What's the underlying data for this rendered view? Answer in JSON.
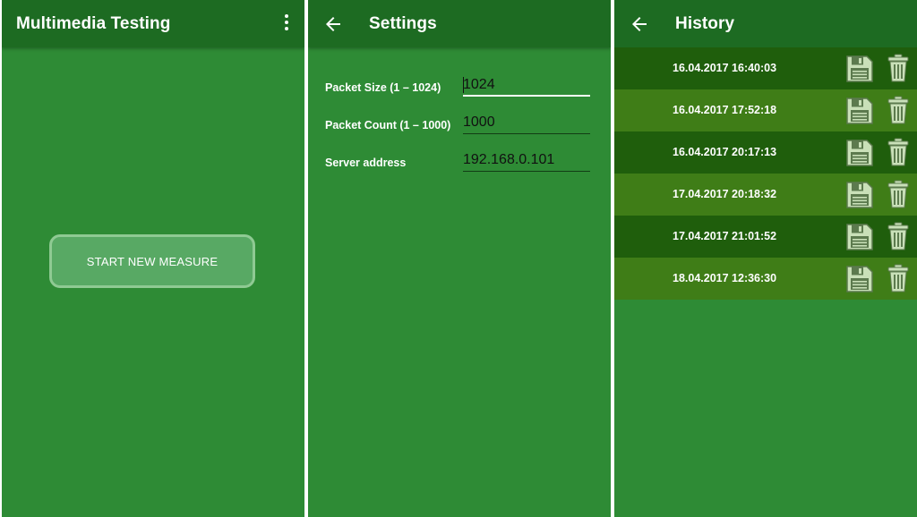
{
  "main": {
    "title": "Multimedia Testing",
    "start_button": "START NEW MEASURE"
  },
  "settings": {
    "title": "Settings",
    "fields": [
      {
        "label": "Packet Size (1 – 1024)",
        "value": "1024"
      },
      {
        "label": "Packet Count (1 – 1000)",
        "value": "1000"
      },
      {
        "label": "Server address",
        "value": "192.168.0.101"
      }
    ]
  },
  "history": {
    "title": "History",
    "entries": [
      {
        "timestamp": "16.04.2017 16:40:03"
      },
      {
        "timestamp": "16.04.2017 17:52:18"
      },
      {
        "timestamp": "16.04.2017 20:17:13"
      },
      {
        "timestamp": "17.04.2017 20:18:32"
      },
      {
        "timestamp": "17.04.2017 21:01:52"
      },
      {
        "timestamp": "18.04.2017 12:36:30"
      }
    ]
  },
  "colors": {
    "background": "#2e8b35",
    "appbar": "#1d6b22",
    "row_dark": "#1f5e0c",
    "row_light": "#3f7d17",
    "icon": "#c9e0b8"
  },
  "icons": [
    "overflow-menu-icon",
    "back-arrow-icon",
    "save-icon",
    "trash-icon"
  ]
}
